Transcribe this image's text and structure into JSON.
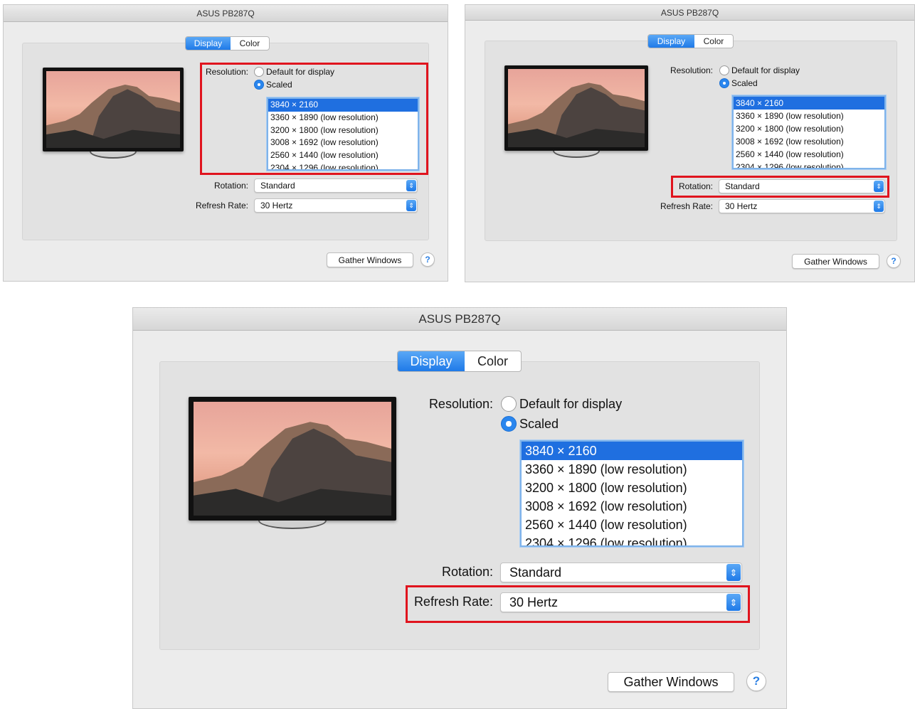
{
  "window_title": "ASUS PB287Q",
  "tabs": [
    {
      "label": "Display",
      "active": true
    },
    {
      "label": "Color",
      "active": false
    }
  ],
  "resolution": {
    "label": "Resolution:",
    "options": [
      {
        "label": "Default for display",
        "selected": false
      },
      {
        "label": "Scaled",
        "selected": true
      }
    ],
    "list": [
      "3840 × 2160",
      "3360 × 1890 (low resolution)",
      "3200 × 1800 (low resolution)",
      "3008 × 1692 (low resolution)",
      "2560 × 1440 (low resolution)",
      "2304 × 1296 (low resolution)"
    ],
    "selected_index": 0
  },
  "rotation": {
    "label": "Rotation:",
    "value": "Standard"
  },
  "refresh_rate": {
    "label": "Refresh Rate:",
    "value": "30 Hertz"
  },
  "gather_windows_label": "Gather Windows",
  "help_label": "?",
  "colors": {
    "accent": "#2a86ee",
    "highlight": "#e0141e"
  },
  "icons": {
    "monitor": "monitor-preview-icon",
    "select_arrow": "up-down-chevron-icon",
    "help": "help-icon"
  },
  "panels": [
    {
      "name": "top-left",
      "highlighted": "resolution"
    },
    {
      "name": "top-right",
      "highlighted": "rotation"
    },
    {
      "name": "bottom",
      "highlighted": "refresh-rate"
    }
  ]
}
